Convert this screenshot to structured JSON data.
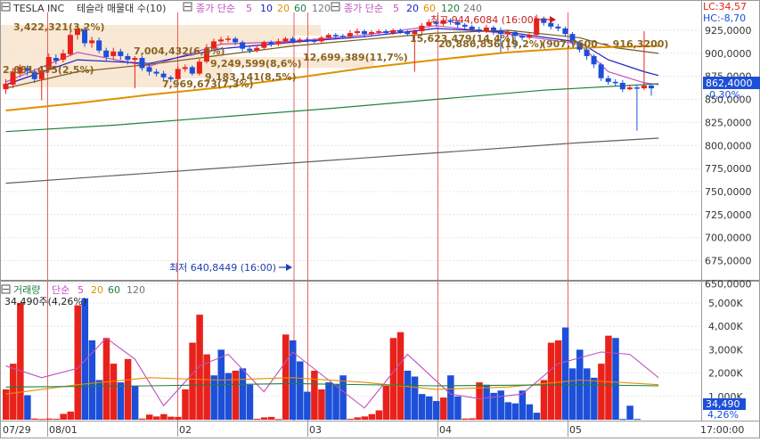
{
  "header": {
    "symbol": "TESLA INC",
    "indicator_title": "테슬라 매물대 수(10)",
    "ma_label": "종가 단순",
    "ma_periods": [
      "5",
      "10",
      "20",
      "60",
      "120"
    ],
    "ma2_label": "종가 단순",
    "ma2_periods": [
      "5",
      "20",
      "60",
      "120",
      "240"
    ],
    "lc": "LC:34,57",
    "hc": "HC:-8,70"
  },
  "price_panel": {
    "y_ticks": [
      "925,0000",
      "900,0000",
      "875,0000",
      "850,0000",
      "825,0000",
      "800,0000",
      "775,0000",
      "750,0000",
      "725,0000",
      "700,0000",
      "675,0000",
      "650,0000"
    ],
    "current_price": "862,4000",
    "current_change": "-0,30%",
    "high_marker": "최고 944,6084 (16:00)",
    "low_marker": "최저 640,8449 (16:00)",
    "volume_profile_labels": [
      "3,422,321(3,2%)",
      "2,681,475(2,5%)",
      "7,004,432(6,5%)",
      "9,249,599(8,6%)",
      "7,969,673(7,3%)",
      "9,183,141(8,5%)",
      "12,699,389(11,7%)",
      "15,623,479(14,4%)",
      "20,886,856(19,2%)",
      "(907,7600 ~ 916,3200)"
    ]
  },
  "volume_panel": {
    "title": "거래량",
    "ma_label": "단순",
    "ma_periods": [
      "5",
      "20",
      "60",
      "120"
    ],
    "current_volume_label": "34,490주(4,26%)",
    "y_ticks": [
      "5,000K",
      "4,000K",
      "3,000K",
      "2,000K",
      "1,000K"
    ],
    "current_volume": "34,490",
    "current_pct": "4,26%"
  },
  "x_axis": {
    "labels": [
      "07/29",
      "08/01",
      "02",
      "03",
      "04",
      "05",
      "17:00:00"
    ]
  },
  "colors": {
    "up": "#e8221b",
    "down": "#1d4fd8",
    "ma5": "#c050c0",
    "ma10": "#2020c0",
    "ma20": "#e09000",
    "ma60": "#208040",
    "ma120": "#606060",
    "profile_fill": "#f7e6cf"
  },
  "chart_data": {
    "type": "candlestick",
    "title": "TESLA INC",
    "candles": [
      {
        "o": 861,
        "c": 867,
        "h": 872,
        "l": 856
      },
      {
        "o": 866,
        "c": 880,
        "h": 884,
        "l": 862
      },
      {
        "o": 878,
        "c": 885,
        "h": 888,
        "l": 874
      },
      {
        "o": 884,
        "c": 881,
        "h": 887,
        "l": 876
      },
      {
        "o": 880,
        "c": 872,
        "h": 883,
        "l": 868
      },
      {
        "o": 872,
        "c": 882,
        "h": 886,
        "l": 849
      },
      {
        "o": 882,
        "c": 896,
        "h": 900,
        "l": 879
      },
      {
        "o": 895,
        "c": 892,
        "h": 899,
        "l": 888
      },
      {
        "o": 893,
        "c": 900,
        "h": 904,
        "l": 890
      },
      {
        "o": 899,
        "c": 920,
        "h": 924,
        "l": 897
      },
      {
        "o": 920,
        "c": 927,
        "h": 931,
        "l": 915
      },
      {
        "o": 926,
        "c": 911,
        "h": 929,
        "l": 907
      },
      {
        "o": 911,
        "c": 914,
        "h": 918,
        "l": 906
      },
      {
        "o": 914,
        "c": 903,
        "h": 917,
        "l": 900
      },
      {
        "o": 903,
        "c": 896,
        "h": 906,
        "l": 892
      },
      {
        "o": 897,
        "c": 902,
        "h": 906,
        "l": 893
      },
      {
        "o": 902,
        "c": 897,
        "h": 905,
        "l": 893
      },
      {
        "o": 897,
        "c": 893,
        "h": 900,
        "l": 888
      },
      {
        "o": 893,
        "c": 895,
        "h": 897,
        "l": 862
      },
      {
        "o": 895,
        "c": 884,
        "h": 897,
        "l": 881
      },
      {
        "o": 885,
        "c": 880,
        "h": 888,
        "l": 876
      },
      {
        "o": 880,
        "c": 878,
        "h": 883,
        "l": 875
      },
      {
        "o": 878,
        "c": 874,
        "h": 881,
        "l": 870
      },
      {
        "o": 874,
        "c": 872,
        "h": 876,
        "l": 869
      },
      {
        "o": 872,
        "c": 883,
        "h": 886,
        "l": 870
      },
      {
        "o": 883,
        "c": 885,
        "h": 888,
        "l": 880
      },
      {
        "o": 885,
        "c": 878,
        "h": 887,
        "l": 876
      },
      {
        "o": 878,
        "c": 891,
        "h": 894,
        "l": 876
      },
      {
        "o": 891,
        "c": 905,
        "h": 910,
        "l": 889
      },
      {
        "o": 905,
        "c": 913,
        "h": 916,
        "l": 902
      },
      {
        "o": 913,
        "c": 915,
        "h": 918,
        "l": 910
      },
      {
        "o": 915,
        "c": 916,
        "h": 919,
        "l": 912
      },
      {
        "o": 916,
        "c": 912,
        "h": 918,
        "l": 909
      },
      {
        "o": 912,
        "c": 905,
        "h": 914,
        "l": 902
      },
      {
        "o": 905,
        "c": 903,
        "h": 907,
        "l": 900
      },
      {
        "o": 903,
        "c": 906,
        "h": 909,
        "l": 901
      },
      {
        "o": 906,
        "c": 912,
        "h": 914,
        "l": 904
      },
      {
        "o": 912,
        "c": 910,
        "h": 914,
        "l": 907
      },
      {
        "o": 910,
        "c": 913,
        "h": 916,
        "l": 908
      },
      {
        "o": 913,
        "c": 916,
        "h": 918,
        "l": 911
      },
      {
        "o": 916,
        "c": 913,
        "h": 918,
        "l": 911
      },
      {
        "o": 913,
        "c": 915,
        "h": 917,
        "l": 911
      },
      {
        "o": 915,
        "c": 914,
        "h": 917,
        "l": 912
      },
      {
        "o": 914,
        "c": 913,
        "h": 916,
        "l": 911
      },
      {
        "o": 913,
        "c": 917,
        "h": 919,
        "l": 911
      },
      {
        "o": 917,
        "c": 920,
        "h": 922,
        "l": 915
      },
      {
        "o": 920,
        "c": 919,
        "h": 922,
        "l": 916
      },
      {
        "o": 919,
        "c": 918,
        "h": 921,
        "l": 916
      },
      {
        "o": 918,
        "c": 922,
        "h": 925,
        "l": 916
      },
      {
        "o": 922,
        "c": 924,
        "h": 927,
        "l": 920
      },
      {
        "o": 924,
        "c": 921,
        "h": 926,
        "l": 917
      },
      {
        "o": 921,
        "c": 923,
        "h": 925,
        "l": 919
      },
      {
        "o": 923,
        "c": 924,
        "h": 926,
        "l": 921
      },
      {
        "o": 924,
        "c": 922,
        "h": 926,
        "l": 920
      },
      {
        "o": 922,
        "c": 925,
        "h": 927,
        "l": 920
      },
      {
        "o": 925,
        "c": 923,
        "h": 927,
        "l": 921
      },
      {
        "o": 923,
        "c": 921,
        "h": 925,
        "l": 919
      },
      {
        "o": 921,
        "c": 924,
        "h": 926,
        "l": 880
      },
      {
        "o": 924,
        "c": 930,
        "h": 933,
        "l": 921
      },
      {
        "o": 930,
        "c": 934,
        "h": 937,
        "l": 928
      },
      {
        "o": 934,
        "c": 932,
        "h": 936,
        "l": 929
      },
      {
        "o": 932,
        "c": 936,
        "h": 939,
        "l": 930
      },
      {
        "o": 936,
        "c": 934,
        "h": 938,
        "l": 931
      },
      {
        "o": 934,
        "c": 931,
        "h": 936,
        "l": 928
      },
      {
        "o": 931,
        "c": 929,
        "h": 933,
        "l": 926
      },
      {
        "o": 929,
        "c": 926,
        "h": 931,
        "l": 923
      },
      {
        "o": 926,
        "c": 924,
        "h": 929,
        "l": 922
      },
      {
        "o": 924,
        "c": 928,
        "h": 931,
        "l": 922
      },
      {
        "o": 928,
        "c": 925,
        "h": 930,
        "l": 920
      },
      {
        "o": 925,
        "c": 921,
        "h": 928,
        "l": 901
      },
      {
        "o": 921,
        "c": 923,
        "h": 926,
        "l": 903
      },
      {
        "o": 923,
        "c": 919,
        "h": 925,
        "l": 905
      },
      {
        "o": 919,
        "c": 917,
        "h": 921,
        "l": 914
      },
      {
        "o": 917,
        "c": 920,
        "h": 923,
        "l": 915
      },
      {
        "o": 920,
        "c": 938,
        "h": 942,
        "l": 918
      },
      {
        "o": 938,
        "c": 933,
        "h": 940,
        "l": 930
      },
      {
        "o": 933,
        "c": 929,
        "h": 936,
        "l": 926
      },
      {
        "o": 929,
        "c": 927,
        "h": 932,
        "l": 924
      },
      {
        "o": 927,
        "c": 921,
        "h": 929,
        "l": 918
      },
      {
        "o": 921,
        "c": 912,
        "h": 923,
        "l": 909
      },
      {
        "o": 912,
        "c": 904,
        "h": 914,
        "l": 901
      },
      {
        "o": 904,
        "c": 897,
        "h": 906,
        "l": 893
      },
      {
        "o": 897,
        "c": 888,
        "h": 899,
        "l": 884
      },
      {
        "o": 888,
        "c": 873,
        "h": 890,
        "l": 870
      },
      {
        "o": 873,
        "c": 869,
        "h": 876,
        "l": 866
      },
      {
        "o": 869,
        "c": 868,
        "h": 872,
        "l": 864
      },
      {
        "o": 868,
        "c": 861,
        "h": 871,
        "l": 858
      },
      {
        "o": 861,
        "c": 863,
        "h": 866,
        "l": 860
      },
      {
        "o": 863,
        "c": 862,
        "h": 866,
        "l": 816
      },
      {
        "o": 862,
        "c": 865,
        "h": 924,
        "l": 860
      },
      {
        "o": 865,
        "c": 862,
        "h": 867,
        "l": 854
      }
    ],
    "ma_series": [
      {
        "name": "5",
        "color": "#c050c0",
        "points": [
          [
            0,
            869
          ],
          [
            10,
            901
          ],
          [
            20,
            886
          ],
          [
            30,
            910
          ],
          [
            40,
            913
          ],
          [
            50,
            920
          ],
          [
            60,
            930
          ],
          [
            70,
            921
          ],
          [
            80,
            910
          ],
          [
            84,
            880
          ],
          [
            89,
            868
          ],
          [
            91,
            866
          ]
        ]
      },
      {
        "name": "10",
        "color": "#2020c0",
        "points": [
          [
            0,
            866
          ],
          [
            10,
            893
          ],
          [
            20,
            889
          ],
          [
            30,
            905
          ],
          [
            40,
            912
          ],
          [
            50,
            918
          ],
          [
            60,
            927
          ],
          [
            70,
            923
          ],
          [
            80,
            912
          ],
          [
            84,
            893
          ],
          [
            89,
            880
          ],
          [
            91,
            876
          ]
        ]
      },
      {
        "name": "20",
        "color": "#7a5a20",
        "points": [
          [
            0,
            862
          ],
          [
            10,
            880
          ],
          [
            20,
            888
          ],
          [
            30,
            898
          ],
          [
            40,
            908
          ],
          [
            50,
            915
          ],
          [
            60,
            922
          ],
          [
            70,
            925
          ],
          [
            80,
            917
          ],
          [
            85,
            906
          ],
          [
            91,
            900
          ]
        ]
      },
      {
        "name": "60",
        "color": "#e09000",
        "points": [
          [
            0,
            838
          ],
          [
            10,
            846
          ],
          [
            20,
            855
          ],
          [
            30,
            863
          ],
          [
            40,
            873
          ],
          [
            50,
            884
          ],
          [
            60,
            893
          ],
          [
            70,
            901
          ],
          [
            80,
            906
          ],
          [
            91,
            908
          ]
        ]
      },
      {
        "name": "120",
        "color": "#208040",
        "points": [
          [
            0,
            815
          ],
          [
            15,
            822
          ],
          [
            30,
            831
          ],
          [
            45,
            840
          ],
          [
            60,
            850
          ],
          [
            75,
            860
          ],
          [
            91,
            867
          ]
        ]
      },
      {
        "name": "240",
        "color": "#606060",
        "points": [
          [
            0,
            759
          ],
          [
            20,
            770
          ],
          [
            40,
            781
          ],
          [
            60,
            792
          ],
          [
            80,
            803
          ],
          [
            91,
            808
          ]
        ]
      }
    ],
    "volume": {
      "values": [
        1300,
        2400,
        5000,
        1050,
        50,
        30,
        50,
        40,
        250,
        350,
        4900,
        5200,
        3400,
        1700,
        3500,
        2400,
        1600,
        2600,
        1450,
        50,
        220,
        140,
        240,
        130,
        120,
        1300,
        3300,
        4500,
        2800,
        1900,
        3000,
        2000,
        2100,
        2200,
        1500,
        40,
        100,
        120,
        30,
        3650,
        3400,
        2500,
        1200,
        2100,
        1300,
        1600,
        1500,
        1900,
        40,
        100,
        140,
        240,
        400,
        1450,
        3500,
        3750,
        2100,
        1850,
        1100,
        1000,
        800,
        950,
        1900,
        1000,
        50,
        60,
        1600,
        1500,
        1150,
        1250,
        750,
        700,
        1250,
        660,
        300,
        1700,
        3300,
        3400,
        3950,
        2200,
        3000,
        2200,
        1800,
        2400,
        3600,
        3500,
        34,
        600,
        34
      ],
      "up": [
        true,
        true,
        true,
        false,
        true,
        true,
        true,
        true,
        true,
        true,
        true,
        false,
        false,
        false,
        true,
        true,
        false,
        true,
        false,
        true,
        true,
        true,
        true,
        true,
        true,
        true,
        true,
        true,
        true,
        false,
        false,
        false,
        true,
        false,
        false,
        true,
        true,
        true,
        true,
        true,
        false,
        false,
        false,
        true,
        true,
        false,
        false,
        false,
        true,
        true,
        true,
        true,
        true,
        true,
        true,
        true,
        false,
        false,
        false,
        false,
        false,
        true,
        false,
        false,
        true,
        true,
        true,
        false,
        false,
        false,
        false,
        false,
        false,
        false,
        false,
        true,
        true,
        true,
        false,
        false,
        false,
        false,
        false,
        true,
        true,
        false,
        false,
        false,
        false,
        false
      ]
    },
    "volume_ma": [
      {
        "name": "5",
        "color": "#c050c0",
        "points": [
          [
            0,
            2300
          ],
          [
            5,
            1800
          ],
          [
            10,
            2200
          ],
          [
            14,
            3500
          ],
          [
            18,
            2600
          ],
          [
            22,
            600
          ],
          [
            27,
            2300
          ],
          [
            31,
            2800
          ],
          [
            36,
            1200
          ],
          [
            40,
            2900
          ],
          [
            45,
            1700
          ],
          [
            50,
            500
          ],
          [
            56,
            2800
          ],
          [
            62,
            1100
          ],
          [
            66,
            900
          ],
          [
            72,
            1100
          ],
          [
            77,
            2400
          ],
          [
            83,
            2900
          ],
          [
            87,
            2800
          ],
          [
            91,
            1800
          ]
        ]
      },
      {
        "name": "20",
        "color": "#e09000",
        "points": [
          [
            0,
            1100
          ],
          [
            10,
            1500
          ],
          [
            20,
            1800
          ],
          [
            30,
            1700
          ],
          [
            40,
            1800
          ],
          [
            50,
            1600
          ],
          [
            60,
            1300
          ],
          [
            70,
            1400
          ],
          [
            80,
            1700
          ],
          [
            91,
            1500
          ]
        ]
      },
      {
        "name": "60",
        "color": "#208040",
        "points": [
          [
            0,
            1400
          ],
          [
            20,
            1450
          ],
          [
            40,
            1550
          ],
          [
            60,
            1450
          ],
          [
            80,
            1500
          ],
          [
            91,
            1450
          ]
        ]
      }
    ]
  }
}
